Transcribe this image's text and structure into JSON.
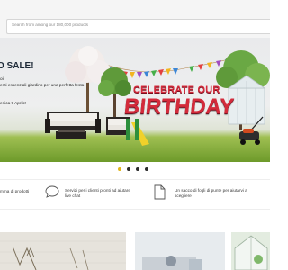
{
  "search": {
    "placeholder": "Search from among our 180,000 products"
  },
  "hero": {
    "sale_title": "O SALE!",
    "line_1": "oil",
    "line_2": "enti essenziali giardino per una perfetta festa",
    "line_3": "enica 9 Aprile!",
    "celebrate_text": "CELEBRATE OUR",
    "birthday_text": "BIRTHDAY",
    "carousel_slides": 4,
    "active_slide": 1
  },
  "features": [
    {
      "icon": "list-icon",
      "text_1": "mma di prodotti",
      "text_2": ""
    },
    {
      "icon": "chat-bubble-icon",
      "text_1": "Servizi per i clienti pronti ad aiutare",
      "text_2": "live chat"
    },
    {
      "icon": "document-icon",
      "text_1": "Un sacco di fogli di punte per aiutarvi a",
      "text_2": "scegliere"
    }
  ],
  "colors": {
    "accent_yellow": "#e0b51a",
    "birthday_red": "#d42b3b",
    "grass_green": "#6d9a2a"
  }
}
